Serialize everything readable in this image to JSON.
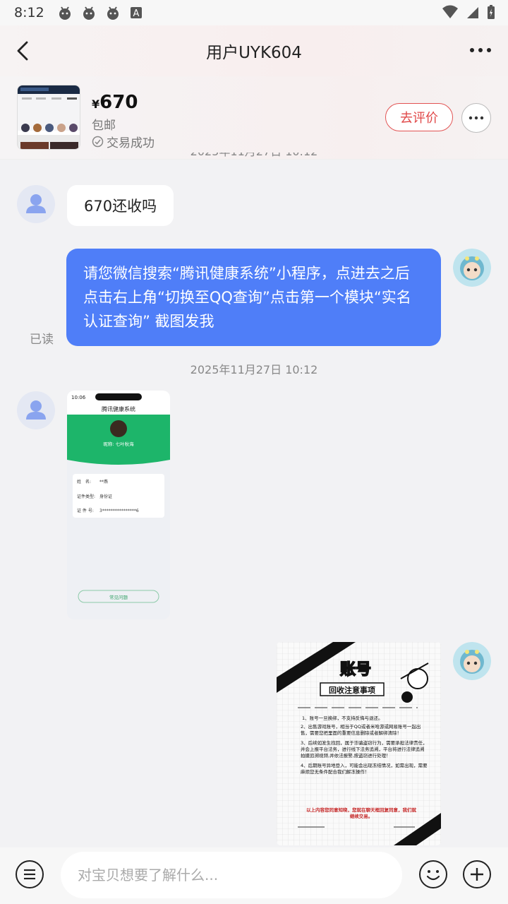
{
  "status_bar": {
    "time": "8:12"
  },
  "header": {
    "title": "用户UYK604"
  },
  "product": {
    "currency": "¥",
    "price": "670",
    "shipping": "包邮",
    "deal_status": "交易成功",
    "review_button": "去评价"
  },
  "messages": {
    "partial_timestamp": "2025年11月27日 10:12",
    "msg1": "670还收吗",
    "msg2": "请您微信搜索“腾讯健康系统”小程序，点进去之后点击右上角“切换至QQ查询”点击第一个模块“实名认证查询” 截图发我",
    "read_label": "已读",
    "timestamp2": "2025年11月27日 10:12"
  },
  "shot1": {
    "status_time": "10:06",
    "app_title": "腾讯健康系统",
    "nickname": "昵称: 七叶秋海",
    "name_label": "姓　名:",
    "name_value": "**燕",
    "idtype_label": "证件类型:",
    "idtype_value": "身份证",
    "idno_label": "证 件 号:",
    "idno_value": "3****************6",
    "bottom_btn": "常见问题"
  },
  "shot2": {
    "title": "账号",
    "subtitle": "回收注意事项",
    "rule1": "1、账号一旦换绑，不支持反悔与退还。",
    "rule2": "2、出售游戏账号，相当于QQ或者米哈游或网易账号一起出售，需要您把里面的重要信息删除或者解绑清除！",
    "rule3": "3、后续如发生找回，属于诈骗盗窃行为，需要承担法律责任，并会上报平台法务，进行线下法务追溯，平台将进行法律追溯拍摄追溯视频,并依法报警,按盗窃进行处理！",
    "rule4": "4、后期账号异地登入，可能会出现冻结情况，如需出现，需要麻烦您无条件配合我们解冻操作！",
    "footer": "以上内容您同意知晓，您就在聊天框回复同意，我们就继续交易。"
  },
  "composer": {
    "placeholder": "对宝贝想要了解什么..."
  }
}
